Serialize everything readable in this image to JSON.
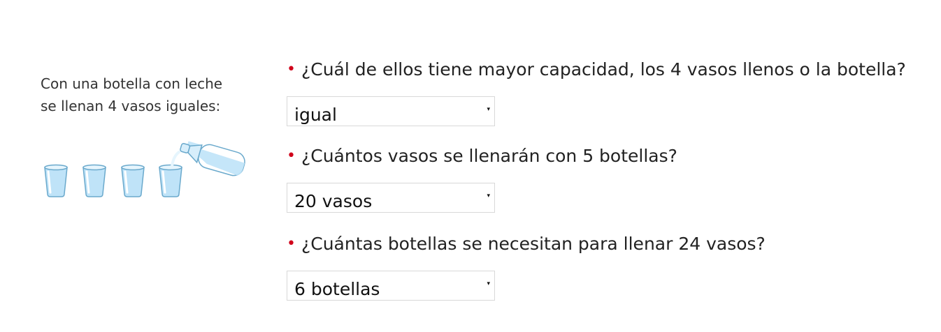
{
  "intro": {
    "line1": "Con una botella con leche",
    "line2": "se llenan 4 vasos iguales:"
  },
  "illustration": {
    "glass_count": 4,
    "glass_icon": "glass-icon",
    "bottle_icon": "milk-bottle-icon"
  },
  "colors": {
    "bullet": "#d0021b",
    "milk_blue": "#bfe3f8",
    "outline": "#6aa9cc"
  },
  "questions": [
    {
      "text": "¿Cuál de ellos tiene mayor capacidad, los 4 vasos llenos o la botella?",
      "selected": "igual"
    },
    {
      "text": "¿Cuántos vasos se llenarán con 5 botellas?",
      "selected": "20 vasos"
    },
    {
      "text": "¿Cuántas botellas se necesitan para llenar 24 vasos?",
      "selected": "6 botellas"
    }
  ],
  "bullet": "•",
  "dropdown_arrow": "▾"
}
